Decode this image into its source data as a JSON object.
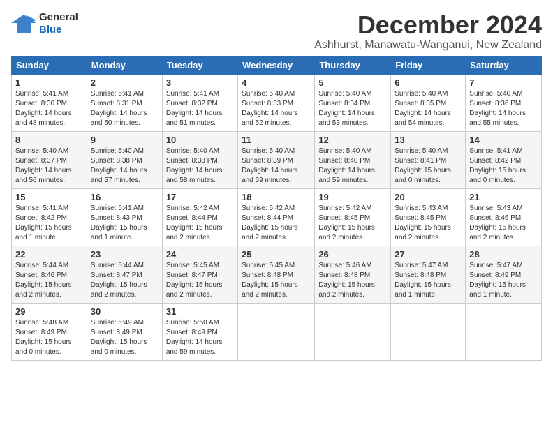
{
  "header": {
    "logo_general": "General",
    "logo_blue": "Blue",
    "title": "December 2024",
    "location": "Ashhurst, Manawatu-Wanganui, New Zealand"
  },
  "weekdays": [
    "Sunday",
    "Monday",
    "Tuesday",
    "Wednesday",
    "Thursday",
    "Friday",
    "Saturday"
  ],
  "weeks": [
    [
      {
        "day": "1",
        "sunrise": "Sunrise: 5:41 AM",
        "sunset": "Sunset: 8:30 PM",
        "daylight": "Daylight: 14 hours and 48 minutes."
      },
      {
        "day": "2",
        "sunrise": "Sunrise: 5:41 AM",
        "sunset": "Sunset: 8:31 PM",
        "daylight": "Daylight: 14 hours and 50 minutes."
      },
      {
        "day": "3",
        "sunrise": "Sunrise: 5:41 AM",
        "sunset": "Sunset: 8:32 PM",
        "daylight": "Daylight: 14 hours and 51 minutes."
      },
      {
        "day": "4",
        "sunrise": "Sunrise: 5:40 AM",
        "sunset": "Sunset: 8:33 PM",
        "daylight": "Daylight: 14 hours and 52 minutes."
      },
      {
        "day": "5",
        "sunrise": "Sunrise: 5:40 AM",
        "sunset": "Sunset: 8:34 PM",
        "daylight": "Daylight: 14 hours and 53 minutes."
      },
      {
        "day": "6",
        "sunrise": "Sunrise: 5:40 AM",
        "sunset": "Sunset: 8:35 PM",
        "daylight": "Daylight: 14 hours and 54 minutes."
      },
      {
        "day": "7",
        "sunrise": "Sunrise: 5:40 AM",
        "sunset": "Sunset: 8:36 PM",
        "daylight": "Daylight: 14 hours and 55 minutes."
      }
    ],
    [
      {
        "day": "8",
        "sunrise": "Sunrise: 5:40 AM",
        "sunset": "Sunset: 8:37 PM",
        "daylight": "Daylight: 14 hours and 56 minutes."
      },
      {
        "day": "9",
        "sunrise": "Sunrise: 5:40 AM",
        "sunset": "Sunset: 8:38 PM",
        "daylight": "Daylight: 14 hours and 57 minutes."
      },
      {
        "day": "10",
        "sunrise": "Sunrise: 5:40 AM",
        "sunset": "Sunset: 8:38 PM",
        "daylight": "Daylight: 14 hours and 58 minutes."
      },
      {
        "day": "11",
        "sunrise": "Sunrise: 5:40 AM",
        "sunset": "Sunset: 8:39 PM",
        "daylight": "Daylight: 14 hours and 59 minutes."
      },
      {
        "day": "12",
        "sunrise": "Sunrise: 5:40 AM",
        "sunset": "Sunset: 8:40 PM",
        "daylight": "Daylight: 14 hours and 59 minutes."
      },
      {
        "day": "13",
        "sunrise": "Sunrise: 5:40 AM",
        "sunset": "Sunset: 8:41 PM",
        "daylight": "Daylight: 15 hours and 0 minutes."
      },
      {
        "day": "14",
        "sunrise": "Sunrise: 5:41 AM",
        "sunset": "Sunset: 8:42 PM",
        "daylight": "Daylight: 15 hours and 0 minutes."
      }
    ],
    [
      {
        "day": "15",
        "sunrise": "Sunrise: 5:41 AM",
        "sunset": "Sunset: 8:42 PM",
        "daylight": "Daylight: 15 hours and 1 minute."
      },
      {
        "day": "16",
        "sunrise": "Sunrise: 5:41 AM",
        "sunset": "Sunset: 8:43 PM",
        "daylight": "Daylight: 15 hours and 1 minute."
      },
      {
        "day": "17",
        "sunrise": "Sunrise: 5:42 AM",
        "sunset": "Sunset: 8:44 PM",
        "daylight": "Daylight: 15 hours and 2 minutes."
      },
      {
        "day": "18",
        "sunrise": "Sunrise: 5:42 AM",
        "sunset": "Sunset: 8:44 PM",
        "daylight": "Daylight: 15 hours and 2 minutes."
      },
      {
        "day": "19",
        "sunrise": "Sunrise: 5:42 AM",
        "sunset": "Sunset: 8:45 PM",
        "daylight": "Daylight: 15 hours and 2 minutes."
      },
      {
        "day": "20",
        "sunrise": "Sunrise: 5:43 AM",
        "sunset": "Sunset: 8:45 PM",
        "daylight": "Daylight: 15 hours and 2 minutes."
      },
      {
        "day": "21",
        "sunrise": "Sunrise: 5:43 AM",
        "sunset": "Sunset: 8:46 PM",
        "daylight": "Daylight: 15 hours and 2 minutes."
      }
    ],
    [
      {
        "day": "22",
        "sunrise": "Sunrise: 5:44 AM",
        "sunset": "Sunset: 8:46 PM",
        "daylight": "Daylight: 15 hours and 2 minutes."
      },
      {
        "day": "23",
        "sunrise": "Sunrise: 5:44 AM",
        "sunset": "Sunset: 8:47 PM",
        "daylight": "Daylight: 15 hours and 2 minutes."
      },
      {
        "day": "24",
        "sunrise": "Sunrise: 5:45 AM",
        "sunset": "Sunset: 8:47 PM",
        "daylight": "Daylight: 15 hours and 2 minutes."
      },
      {
        "day": "25",
        "sunrise": "Sunrise: 5:45 AM",
        "sunset": "Sunset: 8:48 PM",
        "daylight": "Daylight: 15 hours and 2 minutes."
      },
      {
        "day": "26",
        "sunrise": "Sunrise: 5:46 AM",
        "sunset": "Sunset: 8:48 PM",
        "daylight": "Daylight: 15 hours and 2 minutes."
      },
      {
        "day": "27",
        "sunrise": "Sunrise: 5:47 AM",
        "sunset": "Sunset: 8:48 PM",
        "daylight": "Daylight: 15 hours and 1 minute."
      },
      {
        "day": "28",
        "sunrise": "Sunrise: 5:47 AM",
        "sunset": "Sunset: 8:49 PM",
        "daylight": "Daylight: 15 hours and 1 minute."
      }
    ],
    [
      {
        "day": "29",
        "sunrise": "Sunrise: 5:48 AM",
        "sunset": "Sunset: 8:49 PM",
        "daylight": "Daylight: 15 hours and 0 minutes."
      },
      {
        "day": "30",
        "sunrise": "Sunrise: 5:49 AM",
        "sunset": "Sunset: 8:49 PM",
        "daylight": "Daylight: 15 hours and 0 minutes."
      },
      {
        "day": "31",
        "sunrise": "Sunrise: 5:50 AM",
        "sunset": "Sunset: 8:49 PM",
        "daylight": "Daylight: 14 hours and 59 minutes."
      },
      null,
      null,
      null,
      null
    ]
  ]
}
